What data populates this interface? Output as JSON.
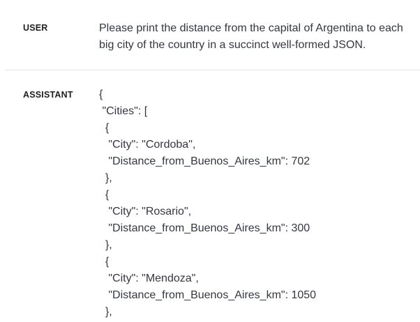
{
  "conversation": {
    "user": {
      "role_label": "USER",
      "message": "Please print the distance from the capital of Argentina to each big city of the country in a succinct well-formed JSON."
    },
    "assistant": {
      "role_label": "ASSISTANT",
      "message": "{\n \"Cities\": [\n  {\n   \"City\": \"Cordoba\",\n   \"Distance_from_Buenos_Aires_km\": 702\n  },\n  {\n   \"City\": \"Rosario\",\n   \"Distance_from_Buenos_Aires_km\": 300\n  },\n  {\n   \"City\": \"Mendoza\",\n   \"Distance_from_Buenos_Aires_km\": 1050\n  },"
    }
  }
}
